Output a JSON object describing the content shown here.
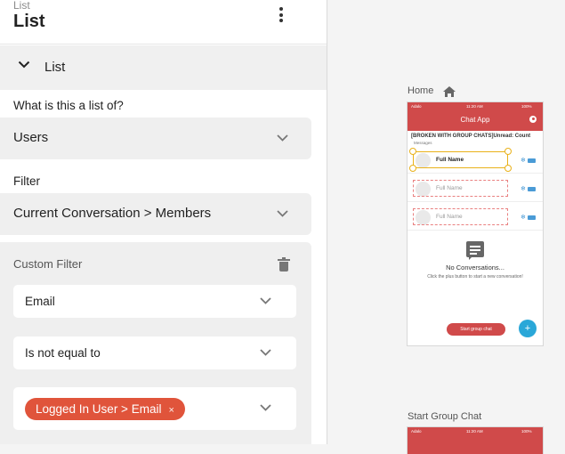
{
  "panel": {
    "subtitle": "List",
    "title": "List",
    "section_label": "List",
    "list_of_label": "What is this a list of?",
    "list_of_value": "Users",
    "filter_label": "Filter",
    "filter_value": "Current Conversation > Members",
    "custom_filter": {
      "title": "Custom Filter",
      "field": "Email",
      "operator": "Is not equal to",
      "value_chip": "Logged In User > Email",
      "chip_close": "×"
    }
  },
  "canvas": {
    "screen1_label": "Home",
    "screen2_label": "Start Group Chat",
    "phone": {
      "carrier": "Adalo",
      "time": "11:20 AM",
      "battery": "100%",
      "app_title": "Chat App",
      "list_header": "[BROKEN WITH GROUP CHATS]Unread: Count",
      "messages_label": "Messages",
      "rows": [
        {
          "name": "Full Name"
        },
        {
          "name": "Full Name"
        },
        {
          "name": "Full Name"
        }
      ],
      "empty_title": "No Conversations...",
      "empty_sub": "Click the plus button to start a new conversation!",
      "group_button": "Start group chat",
      "fab": "+"
    }
  },
  "colors": {
    "brand_red": "#d04a4a",
    "chip_red": "#e0543b",
    "selection_yellow": "#e9b11a",
    "fab_blue": "#2aa7d8"
  }
}
